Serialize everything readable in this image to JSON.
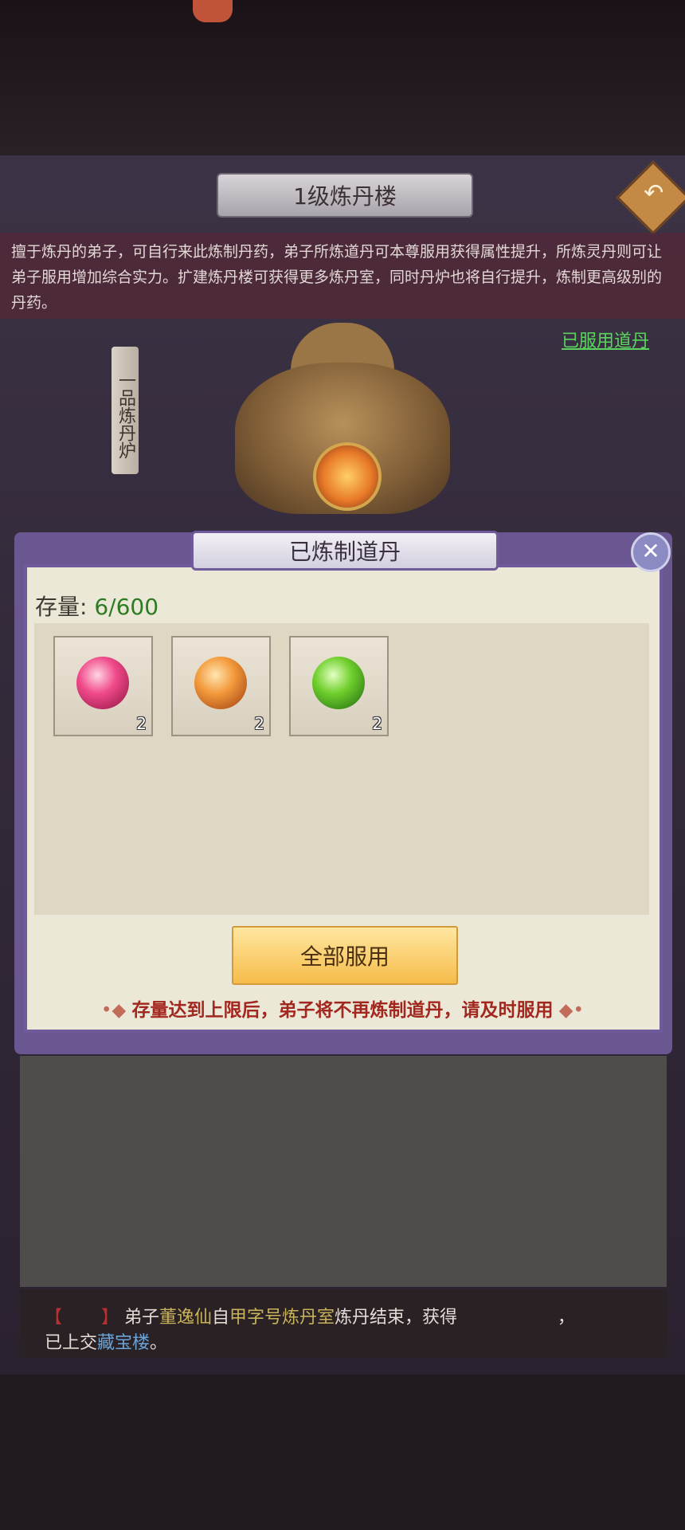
{
  "header": {
    "title": "1级炼丹楼",
    "back_icon": "return-arrow-icon"
  },
  "description": "擅于炼丹的弟子，可自行来此炼制丹药，弟子所炼道丹可本尊服用获得属性提升，所炼灵丹则可让弟子服用增加综合实力。扩建炼丹楼可获得更多炼丹室，同时丹炉也将自行提升，炼制更高级别的丹药。",
  "used_pills_link": "已服用道丹",
  "furnace_label": "一品炼丹炉",
  "dialog": {
    "title": "已炼制道丹",
    "storage_label": "存量:",
    "storage_value": "6/600",
    "items": [
      {
        "icon": "red-pill-orb-icon",
        "count": "2"
      },
      {
        "icon": "orange-pill-orb-icon",
        "count": "2"
      },
      {
        "icon": "green-pill-orb-icon",
        "count": "2"
      }
    ],
    "take_all_button": "全部服用",
    "tip": "存量达到上限后，弟子将不再炼制道丹，请及时服用"
  },
  "log": {
    "prefix": "弟子",
    "disciple_name": "董逸仙",
    "from": "自",
    "room": "甲字号炼丹室",
    "middle": "炼丹结束，获得",
    "comma": "，",
    "line2_prefix": "已上交",
    "destination": "藏宝楼",
    "line2_suffix": "。"
  }
}
